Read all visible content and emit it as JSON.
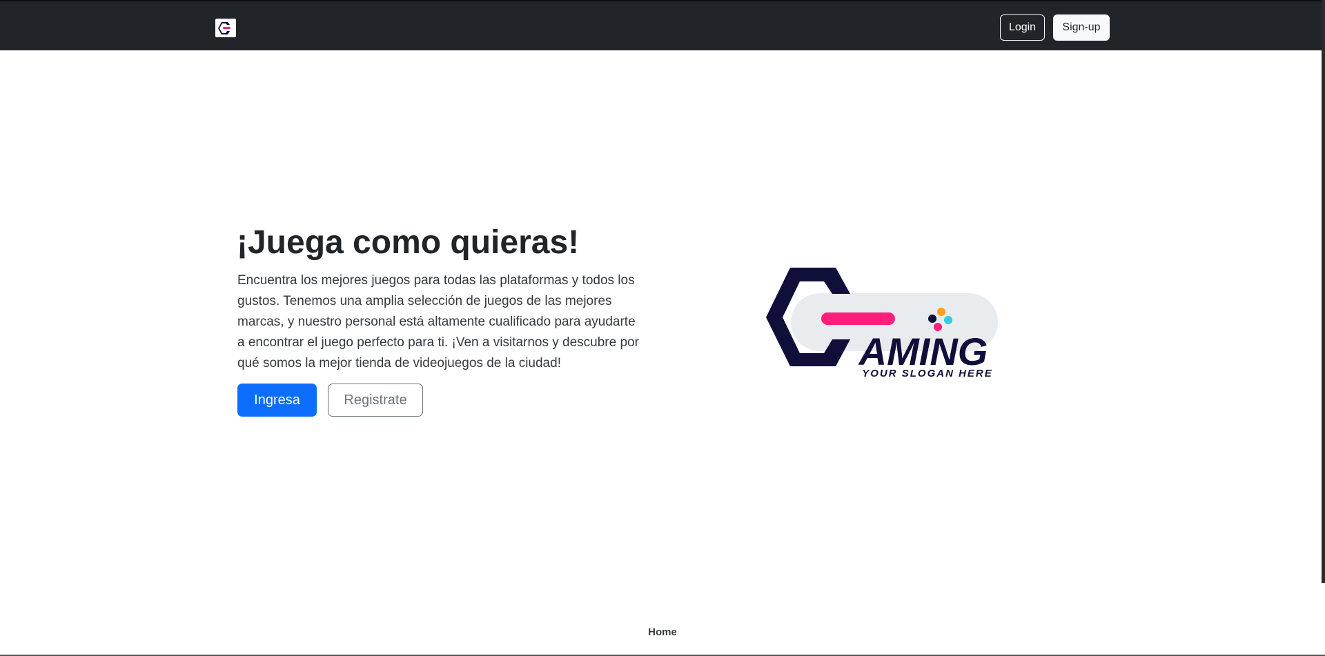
{
  "navbar": {
    "logo_icon": "gaming-logo-icon",
    "login_label": "Login",
    "signup_label": "Sign-up"
  },
  "hero": {
    "title": "¡Juega como quieras!",
    "description": "Encuentra los mejores juegos para todas las plataformas y todos los gustos. Tenemos una amplia selección de juegos de las mejores marcas, y nuestro personal está altamente cualificado para ayudarte a encontrar el juego perfecto para ti. ¡Ven a visitarnos y descubre por qué somos la mejor tienda de videojuegos de la ciudad!",
    "primary_button": "Ingresa",
    "secondary_button": "Registrate",
    "logo": {
      "wordmark": "AMING",
      "slogan": "YOUR SLOGAN HERE"
    }
  },
  "footer": {
    "home_label": "Home"
  },
  "colors": {
    "navbar_bg": "#212529",
    "primary": "#0d6efd",
    "logo_navy": "#0f0f3a",
    "logo_pink": "#ff1f7a",
    "logo_pill": "#e9ecef",
    "dot_orange": "#ff9f1c",
    "dot_cyan": "#2ed0e0"
  }
}
